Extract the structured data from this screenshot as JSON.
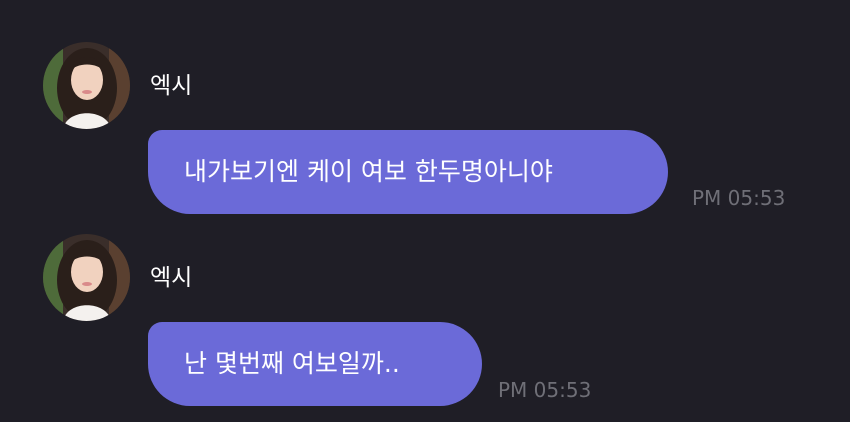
{
  "messages": [
    {
      "sender": "엑시",
      "text": "내가보기엔 케이 여보 한두명아니야",
      "time": "PM 05:53"
    },
    {
      "sender": "엑시",
      "text": "난 몇번째 여보일까..",
      "time": "PM 05:53"
    }
  ],
  "colors": {
    "background": "#1f1e26",
    "bubble": "#6b6ad8",
    "text": "#ffffff",
    "timestamp": "#6f6f77"
  },
  "icons": {
    "avatar": "profile-photo-avatar"
  }
}
